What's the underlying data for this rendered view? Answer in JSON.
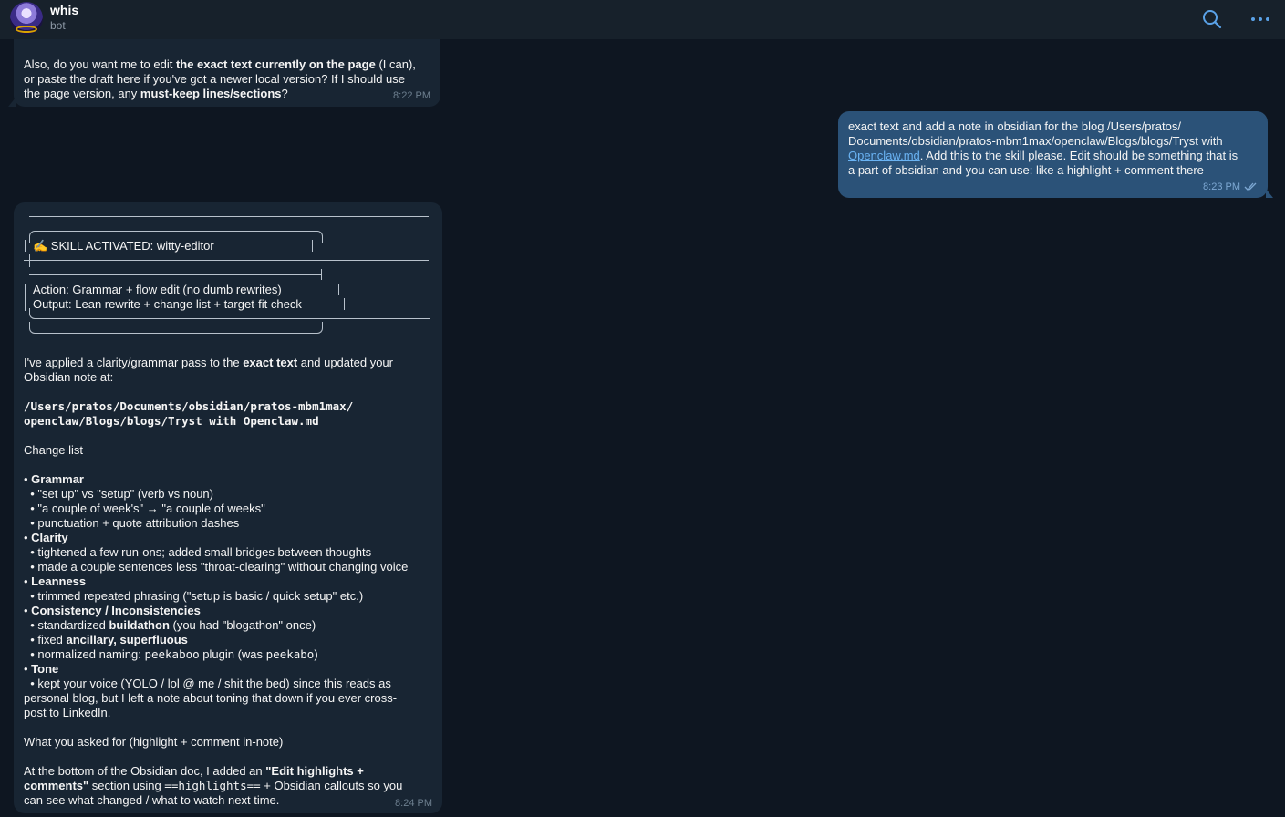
{
  "header": {
    "name": "whis",
    "subtitle": "bot",
    "icons": [
      "search-icon",
      "more-icon"
    ]
  },
  "msg1": {
    "line1_pre": "Also, do you want me to edit ",
    "line1_bold": "the exact text currently on the page",
    "line1_post": " (I can),",
    "line2": "or paste the draft here if you've got a newer local version? If I should use",
    "line3_pre": "the page version, any ",
    "line3_bold": "must-keep lines/sections",
    "line3_post": "?",
    "time": "8:22 PM"
  },
  "msg2": {
    "line1": "exact text and add a note in obsidian for the blog /Users/pratos/",
    "line2": "Documents/obsidian/pratos-mbm1max/openclaw/Blogs/blogs/Tryst with",
    "line3_link": "Openclaw.md",
    "line3_post": ". Add this to the skill please. Edit should be something that is",
    "line4": "a part of obsidian and you can use: like a highlight + comment there",
    "time": "8:23 PM"
  },
  "msg3": {
    "skill_title": "✍️ SKILL ACTIVATED: witty-editor",
    "skill_action": "Action: Grammar + flow edit (no dumb rewrites)",
    "skill_output": "Output: Lean rewrite + change list + target-fit check",
    "intro1_pre": "I've applied a clarity/grammar pass to the ",
    "intro1_bold": "exact text",
    "intro1_post": " and updated your",
    "intro2": "Obsidian note at:",
    "path1": "/Users/pratos/Documents/obsidian/pratos-mbm1max/",
    "path2": "openclaw/Blogs/blogs/Tryst with Openclaw.md",
    "change_list": "Change list",
    "grammar": "Grammar",
    "g1": "\"set up\" vs \"setup\" (verb vs noun)",
    "g2": "\"a couple of week's\" → \"a couple of weeks\"",
    "g3": "punctuation + quote attribution dashes",
    "clarity": "Clarity",
    "c1": "tightened a few run-ons; added small bridges between thoughts",
    "c2": "made a couple sentences less \"throat-clearing\" without changing voice",
    "leanness": "Leanness",
    "l1": "trimmed repeated phrasing (\"setup is basic / quick setup\" etc.)",
    "consistency": "Consistency / Inconsistencies",
    "k1_pre": "standardized ",
    "k1_bold": "buildathon",
    "k1_post": " (you had \"blogathon\" once)",
    "k2_pre": "fixed ",
    "k2_bold": "ancillary, superfluous",
    "k3_pre": "normalized naming: ",
    "k3_code1": "peekaboo",
    "k3_mid": " plugin (was ",
    "k3_code2": "peekabo",
    "k3_post": ")",
    "tone": "Tone",
    "t1": "kept your voice (YOLO / lol @ me / shit the bed) since this reads as",
    "t2": "personal blog, but I left a note about toning that down if you ever cross-",
    "t3": "post to LinkedIn.",
    "asked": "What you asked for (highlight + comment in-note)",
    "bottom1_pre": "At the bottom of the Obsidian doc, I added an ",
    "bottom1_bold": "\"Edit highlights +",
    "bottom2_bold": "comments\"",
    "bottom2_pre": " section using ",
    "bottom2_code": "==highlights==",
    "bottom2_post": " + Obsidian callouts so you",
    "bottom3": "can see what changed / what to watch next time.",
    "time": "8:24 PM"
  },
  "colors": {
    "background": "#0e1621",
    "header": "#17212b",
    "incoming_bubble": "#182533",
    "outgoing_bubble": "#2b5278",
    "link": "#6ab3f3",
    "accent": "#5aa2e8"
  }
}
